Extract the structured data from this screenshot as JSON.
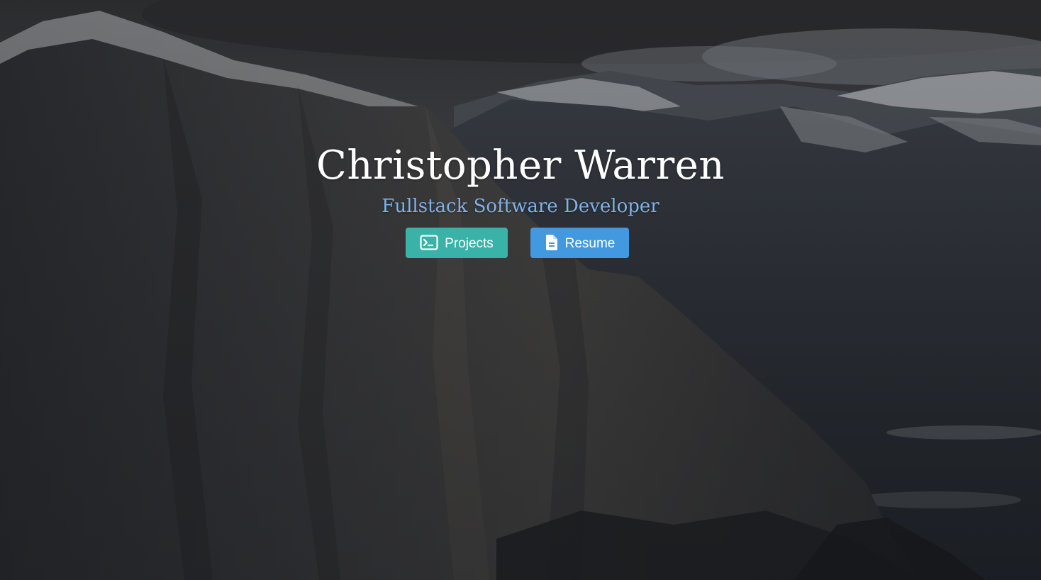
{
  "hero": {
    "name": "Christopher Warren",
    "tagline": "Fullstack Software Developer",
    "background": "mountain-cliff-landscape"
  },
  "actions": {
    "projects": {
      "label": "Projects",
      "icon": "terminal-icon",
      "color": "#39b3a8"
    },
    "resume": {
      "label": "Resume",
      "icon": "document-icon",
      "color": "#4399e0"
    }
  },
  "theme": {
    "title_color": "#ffffff",
    "tagline_color": "#7fb2e8"
  }
}
